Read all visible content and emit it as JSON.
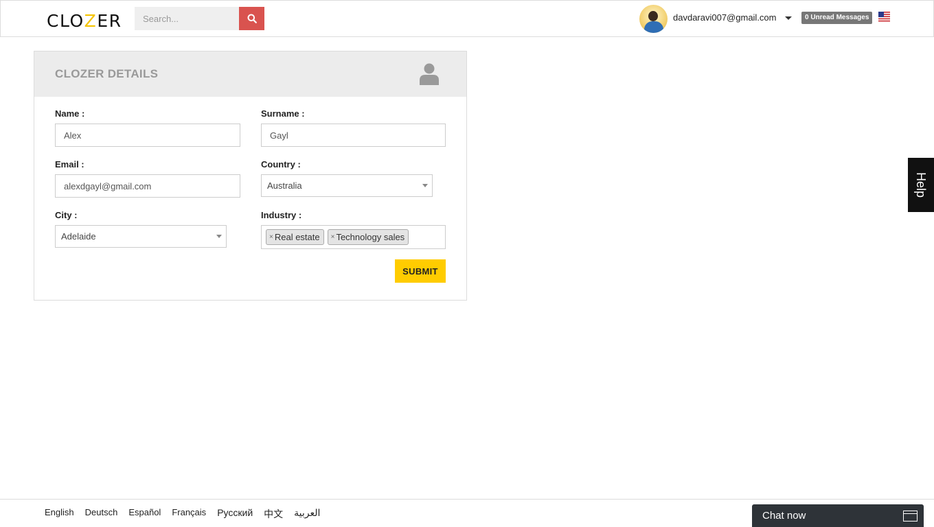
{
  "header": {
    "logo": {
      "part1": "CLO",
      "part2": "Z",
      "part3": "ER"
    },
    "search": {
      "placeholder": "Search...",
      "icon": "search-icon"
    },
    "user_email": "davdaravi007@gmail.com",
    "unread_messages": "0 Unread Messages",
    "language_flag": "us-flag-icon"
  },
  "card": {
    "title": "CLOZER DETAILS",
    "icon": "user-icon",
    "fields": {
      "name": {
        "label": "Name :",
        "value": "Alex"
      },
      "surname": {
        "label": "Surname :",
        "value": "Gayl"
      },
      "email": {
        "label": "Email :",
        "value": "alexdgayl@gmail.com"
      },
      "country": {
        "label": "Country :",
        "value": "Australia"
      },
      "city": {
        "label": "City :",
        "value": "Adelaide"
      },
      "industry": {
        "label": "Industry :",
        "tags": [
          "Real estate",
          "Technology sales"
        ]
      }
    },
    "submit_label": "SUBMIT"
  },
  "help_tab": "Help",
  "footer": {
    "languages": [
      "English",
      "Deutsch",
      "Español",
      "Français",
      "Русский",
      "中文",
      "العربية"
    ]
  },
  "chat": {
    "label": "Chat now"
  },
  "colors": {
    "accent_yellow": "#ffcc00",
    "search_red": "#d9534f",
    "badge_gray": "#777777"
  }
}
